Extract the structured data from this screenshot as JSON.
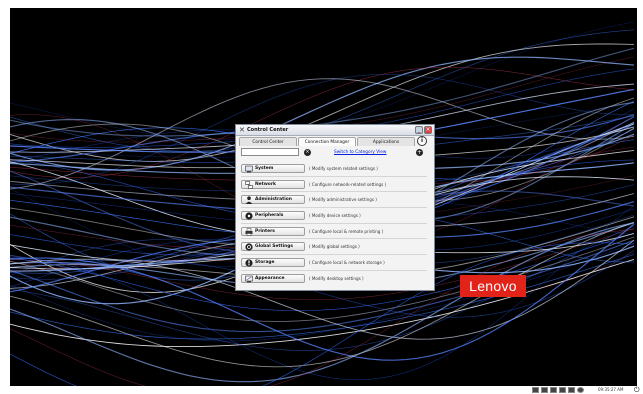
{
  "window": {
    "title": "Control Center",
    "minimize_glyph": "_",
    "close_glyph": "×"
  },
  "tabs": [
    {
      "label": "Control Center"
    },
    {
      "label": "Connection Manager"
    },
    {
      "label": "Applications"
    }
  ],
  "info_glyph": "i",
  "search": {
    "value": "",
    "placeholder": ""
  },
  "category_link": "Switch to Category View",
  "categories": [
    {
      "label": "System",
      "description": "( Modify system related settings )",
      "icon": "system-icon"
    },
    {
      "label": "Network",
      "description": "( Configure network-related settings )",
      "icon": "network-icon"
    },
    {
      "label": "Administration",
      "description": "( Modify administrative settings )",
      "icon": "administration-icon"
    },
    {
      "label": "Peripherals",
      "description": "( Modify device settings )",
      "icon": "peripherals-icon"
    },
    {
      "label": "Printers",
      "description": "( Configure local & remote printing )",
      "icon": "printer-icon"
    },
    {
      "label": "Global Settings",
      "description": "( Modify global settings )",
      "icon": "global-settings-icon"
    },
    {
      "label": "Storage",
      "description": "( Configure local & network storage )",
      "icon": "storage-icon"
    },
    {
      "label": "Appearance",
      "description": "( Modify desktop settings )",
      "icon": "appearance-icon"
    }
  ],
  "brand": {
    "text": "Lenovo",
    "color": "#e2231a"
  },
  "taskbar": {
    "clock": "09:35:27 AM"
  }
}
